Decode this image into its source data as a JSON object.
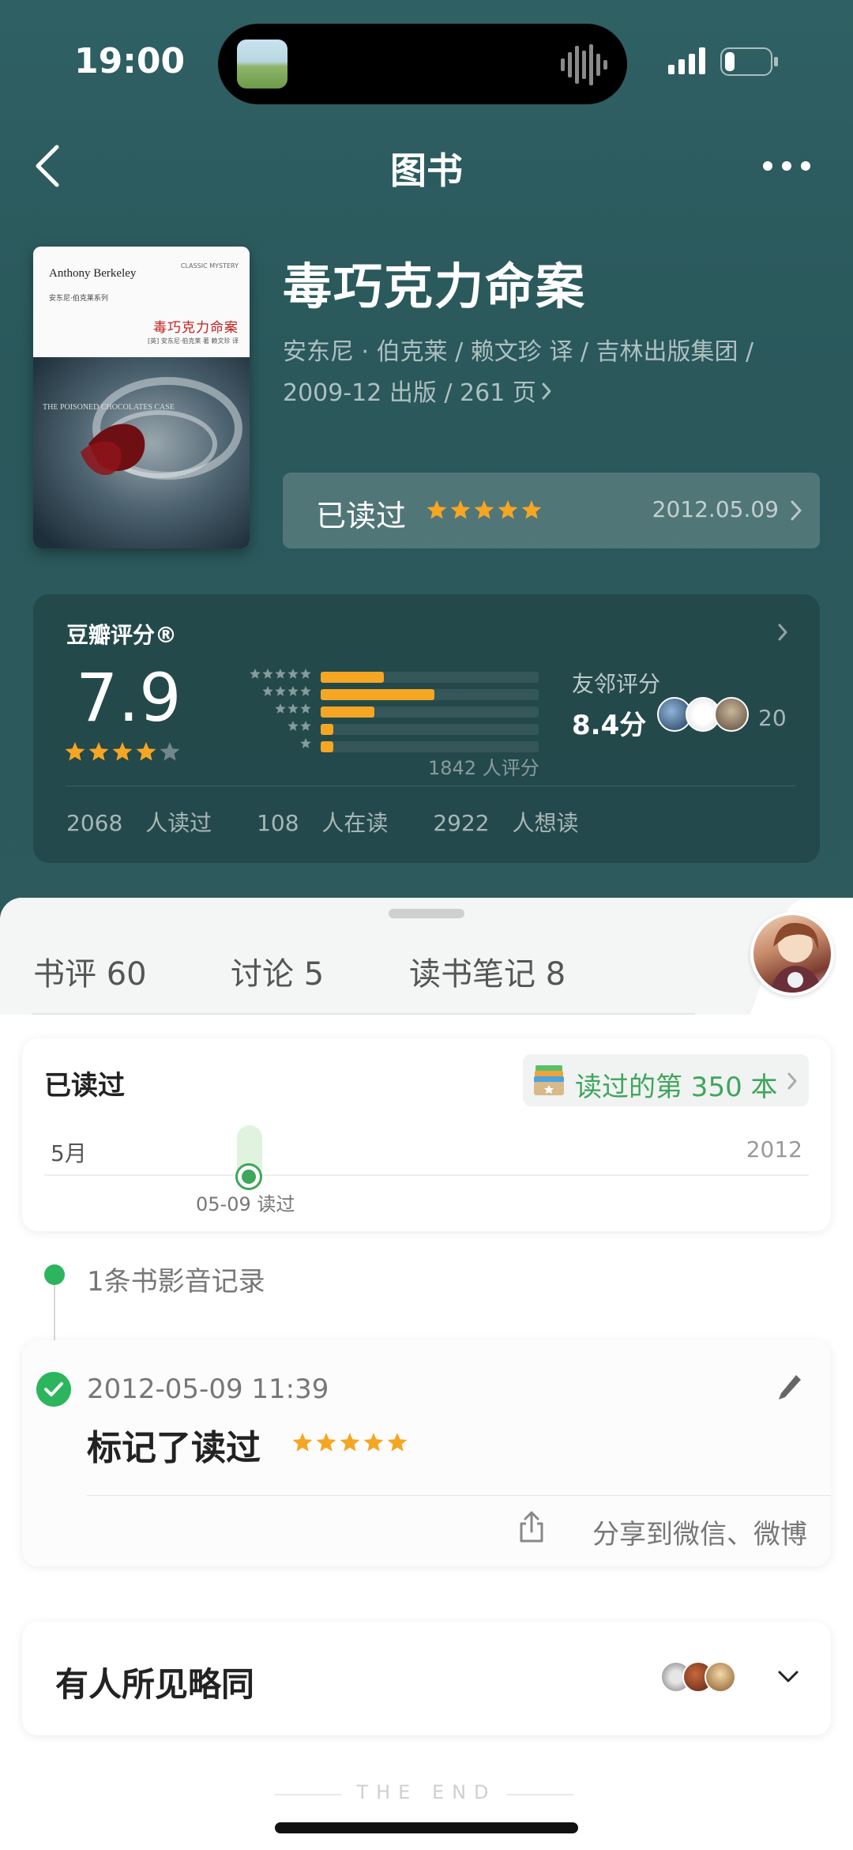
{
  "status_bar": {
    "time": "19:00"
  },
  "nav": {
    "title": "图书",
    "back_icon": "chevron-left-icon",
    "more_icon": "more-dots-icon"
  },
  "book": {
    "cover": {
      "author_en": "Anthony Berkeley",
      "author_cn": "安东尼·伯克莱系列",
      "series": "CLASSIC MYSTERY",
      "title_cn": "毒巧克力命案",
      "translator": "[英] 安东尼·伯克莱 著 赖文珍 译",
      "title_en": "THE POISONED CHOCOLATES CASE"
    },
    "title": "毒巧克力命案",
    "meta_line1": "安东尼 · 伯克莱 / 赖文珍 译 / 吉林出版集团 /",
    "meta_line2": "2009-12 出版 / 261 页",
    "status": {
      "label": "已读过",
      "stars": 5,
      "date": "2012.05.09"
    }
  },
  "rating": {
    "title": "豆瓣评分®",
    "score": "7.9",
    "stars": 4,
    "distribution": [
      0.2,
      0.36,
      0.17,
      0.04,
      0.04
    ],
    "count_text": "1842 人评分",
    "friends_label": "友邻评分",
    "friends_score": "8.4分",
    "friends_count": "20",
    "stats": [
      "2068 人读过",
      "108 人在读",
      "2922 人想读"
    ]
  },
  "tabs": [
    {
      "label": "书评 60"
    },
    {
      "label": "讨论 5"
    },
    {
      "label": "读书笔记 8"
    }
  ],
  "read_card": {
    "title": "已读过",
    "badge": "读过的第 350 本",
    "month": "5月",
    "year": "2012",
    "marker_date": "05-09 读过"
  },
  "records": {
    "title": "1条书影音记录",
    "time": "2012-05-09 11:39",
    "action": "标记了读过",
    "stars": 5,
    "share": "分享到微信、微博"
  },
  "same": {
    "title": "有人所见略同"
  },
  "footer": {
    "end": "THE END"
  },
  "colors": {
    "accent_green": "#2db55d",
    "star": "#f5a623",
    "header_bg": "#2f6063"
  }
}
